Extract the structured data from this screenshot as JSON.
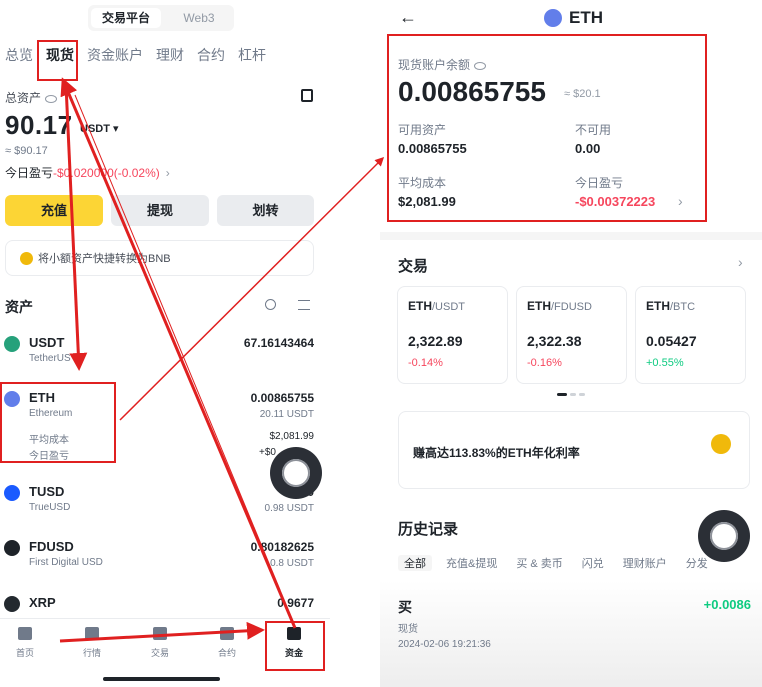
{
  "colors": {
    "accent": "#fcd535",
    "negative": "#f6465d",
    "positive": "#0ecb81",
    "annotation": "#e02020"
  },
  "left": {
    "segment": [
      "交易平台",
      "Web3"
    ],
    "tabs": [
      "总览",
      "现货",
      "资金账户",
      "理财",
      "合约",
      "杠杆"
    ],
    "total_label": "总资产",
    "total_value": "90.17",
    "unit": "USDT ▾",
    "approx": "≈ $90.17",
    "pnl_label": "今日盈亏",
    "pnl_value": "-$0.020000(-0.02%)",
    "pnl_arrow": "›",
    "buttons": [
      "充值",
      "提现",
      "划转"
    ],
    "banner": "将小额资产快捷转换为BNB",
    "assets_title": "资产",
    "coins": [
      {
        "symbol": "USDT",
        "name": "TetherUS",
        "amount": "67.16143464",
        "usd": "",
        "icon": "tether-icon",
        "color": "#26a17b"
      },
      {
        "symbol": "ETH",
        "name": "Ethereum",
        "amount": "0.00865755",
        "usd": "20.11 USDT",
        "icon": "ethereum-icon",
        "color": "#627eea"
      },
      {
        "symbol": "TUSD",
        "name": "TrueUSD",
        "amount": "0",
        "usd": "0.98 USDT",
        "icon": "trueusd-icon",
        "color": "#1a5aff"
      },
      {
        "symbol": "FDUSD",
        "name": "First Digital USD",
        "amount": "0.80182625",
        "usd": "0.8 USDT",
        "icon": "fdusd-icon",
        "color": "#1e2329"
      },
      {
        "symbol": "XRP",
        "name": "",
        "amount": "0.9677",
        "usd": "",
        "icon": "xrp-icon",
        "color": "#23292f"
      }
    ],
    "eth_extra": {
      "avg_label": "平均成本",
      "avg_value": "$2,081.99",
      "pnl_label": "今日盈亏",
      "pnl_value": "+$0"
    },
    "nav": [
      "首页",
      "行情",
      "交易",
      "合约",
      "资金"
    ]
  },
  "right": {
    "title": "ETH",
    "balance_label": "现货账户余额",
    "balance": "0.00865755",
    "balance_approx": "≈ $20.1",
    "available_label": "可用资产",
    "available_value": "0.00865755",
    "unavailable_label": "不可用",
    "unavailable_value": "0.00",
    "avg_label": "平均成本",
    "avg_value": "$2,081.99",
    "pnl_label": "今日盈亏",
    "pnl_value": "-$0.00372223",
    "trade_title": "交易",
    "pairs": [
      {
        "base": "ETH",
        "quote": "/USDT",
        "price": "2,322.89",
        "change": "-0.14%"
      },
      {
        "base": "ETH",
        "quote": "/FDUSD",
        "price": "2,322.38",
        "change": "-0.16%"
      },
      {
        "base": "ETH",
        "quote": "/BTC",
        "price": "0.05427",
        "change": "+0.55%"
      }
    ],
    "promo": "赚高达113.83%的ETH年化利率",
    "history_title": "历史记录",
    "history_tabs": [
      "全部",
      "充值&提现",
      "买 & 卖币",
      "闪兑",
      "理财账户",
      "分发"
    ],
    "record_side": "买",
    "record_amount": "+0.0086",
    "record_type": "现货",
    "record_time": "2024-02-06 19:21:36"
  }
}
